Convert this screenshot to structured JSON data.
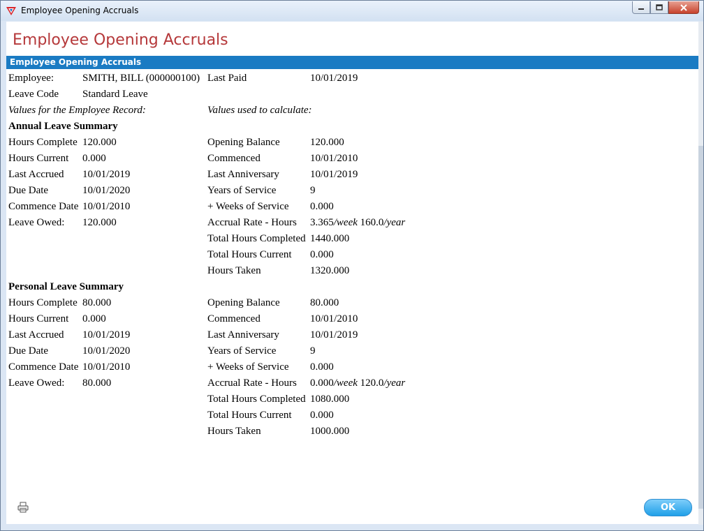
{
  "window": {
    "title": "Employee Opening Accruals"
  },
  "page": {
    "title": "Employee Opening Accruals",
    "section_title": "Employee Opening Accruals"
  },
  "employee": {
    "employee_label": "Employee:",
    "employee_value": "SMITH, BILL (000000100)",
    "last_paid_label": "Last Paid",
    "last_paid_value": "10/01/2019",
    "leave_code_label": "Leave Code",
    "leave_code_value": "Standard Leave",
    "note_left": "Values for the Employee Record:",
    "note_right": "Values used to calculate:"
  },
  "annual": {
    "heading": "Annual Leave Summary",
    "left": [
      {
        "label": "Hours Complete",
        "value": "120.000"
      },
      {
        "label": "Hours Current",
        "value": "0.000"
      },
      {
        "label": "Last Accrued",
        "value": "10/01/2019"
      },
      {
        "label": "Due Date",
        "value": "10/01/2020"
      },
      {
        "label": "Commence Date",
        "value": "10/01/2010"
      },
      {
        "label": "Leave Owed:",
        "value": "120.000"
      }
    ],
    "right": [
      {
        "label": "Opening Balance",
        "value": "120.000"
      },
      {
        "label": "Commenced",
        "value": "10/01/2010"
      },
      {
        "label": "Last Anniversary",
        "value": "10/01/2019"
      },
      {
        "label": "Years of Service",
        "value": "9"
      },
      {
        "label": "+ Weeks of Service",
        "value": "0.000"
      },
      {
        "label": "Accrual Rate - Hours",
        "rate_week": "3.365",
        "unit_week": "/week",
        "rate_year": "160.0",
        "unit_year": "/year"
      },
      {
        "label": "Total Hours Completed",
        "value": "1440.000"
      },
      {
        "label": "Total Hours Current",
        "value": "0.000"
      },
      {
        "label": "Hours Taken",
        "value": "1320.000"
      }
    ]
  },
  "personal": {
    "heading": "Personal Leave Summary",
    "left": [
      {
        "label": "Hours Complete",
        "value": "80.000"
      },
      {
        "label": "Hours Current",
        "value": "0.000"
      },
      {
        "label": "Last Accrued",
        "value": "10/01/2019"
      },
      {
        "label": "Due Date",
        "value": "10/01/2020"
      },
      {
        "label": "Commence Date",
        "value": "10/01/2010"
      },
      {
        "label": "Leave Owed:",
        "value": "80.000"
      }
    ],
    "right": [
      {
        "label": "Opening Balance",
        "value": "80.000"
      },
      {
        "label": "Commenced",
        "value": "10/01/2010"
      },
      {
        "label": "Last Anniversary",
        "value": "10/01/2019"
      },
      {
        "label": "Years of Service",
        "value": "9"
      },
      {
        "label": "+ Weeks of Service",
        "value": "0.000"
      },
      {
        "label": "Accrual Rate - Hours",
        "rate_week": "0.000",
        "unit_week": "/week",
        "rate_year": "120.0",
        "unit_year": "/year"
      },
      {
        "label": "Total Hours Completed",
        "value": "1080.000"
      },
      {
        "label": "Total Hours Current",
        "value": "0.000"
      },
      {
        "label": "Hours Taken",
        "value": "1000.000"
      }
    ]
  },
  "footer": {
    "ok_label": "OK",
    "print_icon": "printer-icon"
  },
  "colors": {
    "title_red": "#b5383a",
    "section_blue": "#1a7bc3",
    "ok_blue": "#20a0e8"
  }
}
